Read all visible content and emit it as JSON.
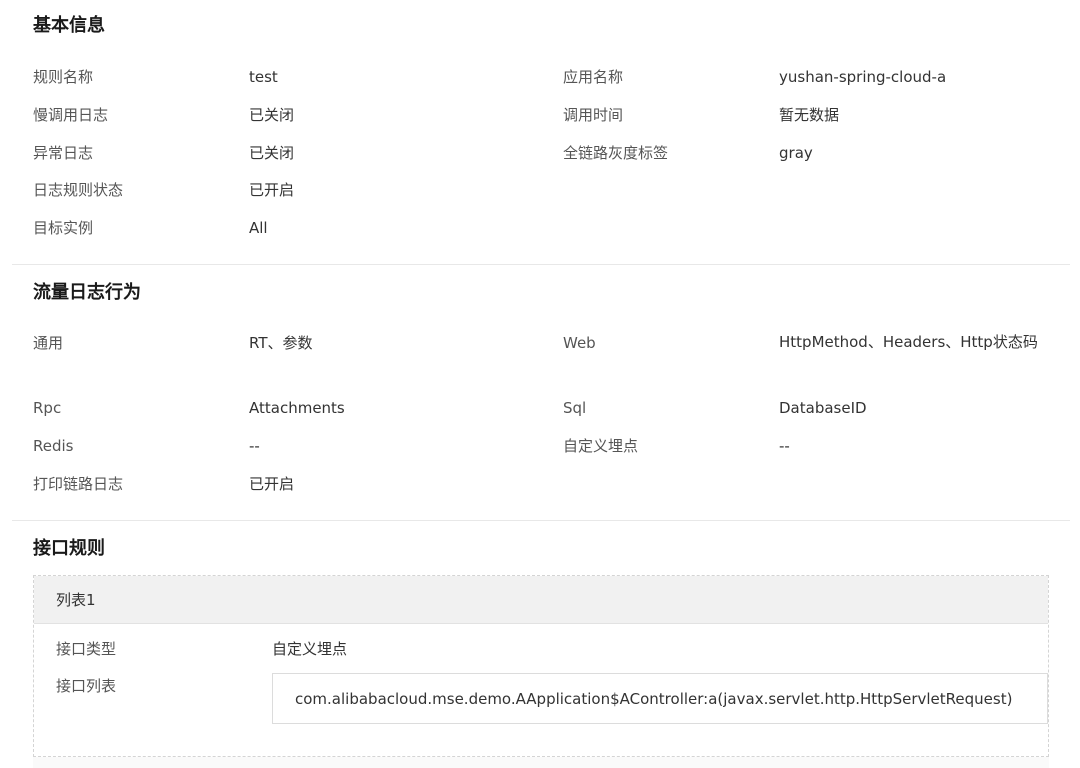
{
  "basic": {
    "title": "基本信息",
    "rule_name_label": "规则名称",
    "rule_name_value": "test",
    "app_name_label": "应用名称",
    "app_name_value": "yushan-spring-cloud-a",
    "slow_log_label": "慢调用日志",
    "slow_log_value": "已关闭",
    "call_time_label": "调用时间",
    "call_time_value": "暂无数据",
    "error_log_label": "异常日志",
    "error_log_value": "已关闭",
    "gray_tag_label": "全链路灰度标签",
    "gray_tag_value": "gray",
    "status_label": "日志规则状态",
    "status_value": "已开启",
    "target_label": "目标实例",
    "target_value": "All"
  },
  "traffic": {
    "title": "流量日志行为",
    "general_label": "通用",
    "general_value": "RT、参数",
    "web_label": "Web",
    "web_value": "HttpMethod、Headers、Http状态码",
    "rpc_label": "Rpc",
    "rpc_value": "Attachments",
    "sql_label": "Sql",
    "sql_value": "DatabaseID",
    "redis_label": "Redis",
    "redis_value": "--",
    "custom_label": "自定义埋点",
    "custom_value": "--",
    "print_label": "打印链路日志",
    "print_value": "已开启"
  },
  "interface": {
    "title": "接口规则",
    "list_title": "列表1",
    "type_label": "接口类型",
    "type_value": "自定义埋点",
    "list_label": "接口列表",
    "list_value": "com.alibabacloud.mse.demo.AApplication$AController:a(javax.servlet.http.HttpServletRequest)"
  }
}
